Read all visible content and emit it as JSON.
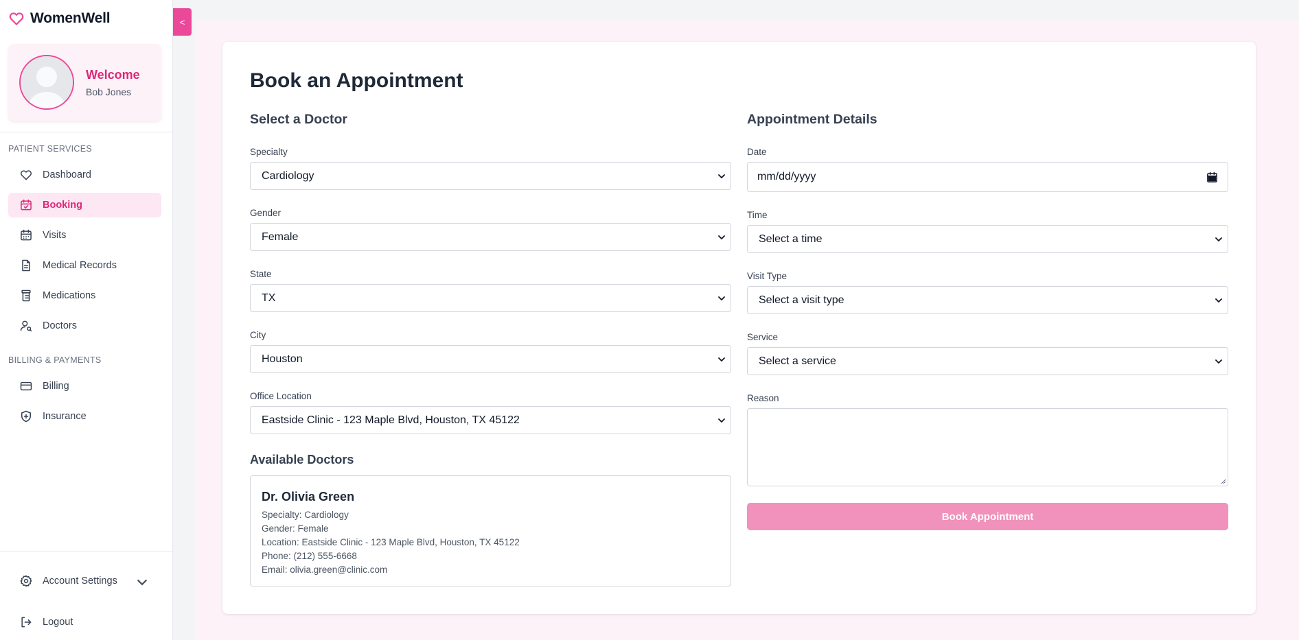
{
  "brand": {
    "name": "WomenWell"
  },
  "user": {
    "welcome": "Welcome",
    "name": "Bob Jones"
  },
  "sidebar": {
    "sections": [
      {
        "label": "PATIENT SERVICES"
      },
      {
        "label": "BILLING & PAYMENTS"
      }
    ],
    "items": [
      {
        "label": "Dashboard",
        "icon": "heart-icon"
      },
      {
        "label": "Booking",
        "icon": "calendar-check-icon",
        "active": true
      },
      {
        "label": "Visits",
        "icon": "calendar-icon"
      },
      {
        "label": "Medical Records",
        "icon": "document-icon"
      },
      {
        "label": "Medications",
        "icon": "pill-bottle-icon"
      },
      {
        "label": "Doctors",
        "icon": "user-search-icon"
      },
      {
        "label": "Billing",
        "icon": "credit-card-icon"
      },
      {
        "label": "Insurance",
        "icon": "shield-plus-icon"
      }
    ],
    "account_settings": "Account Settings",
    "logout": "Logout",
    "collapse": "<"
  },
  "page": {
    "title": "Book an Appointment",
    "doctor_section": "Select a Doctor",
    "details_section": "Appointment Details",
    "available_title": "Available Doctors"
  },
  "doctor_form": {
    "specialty": {
      "label": "Specialty",
      "value": "Cardiology"
    },
    "gender": {
      "label": "Gender",
      "value": "Female"
    },
    "state": {
      "label": "State",
      "value": "TX"
    },
    "city": {
      "label": "City",
      "value": "Houston"
    },
    "office": {
      "label": "Office Location",
      "value": "Eastside Clinic - 123 Maple Blvd, Houston, TX 45122"
    }
  },
  "details_form": {
    "date": {
      "label": "Date",
      "placeholder": "mm/dd/yyyy"
    },
    "time": {
      "label": "Time",
      "value": "Select a time"
    },
    "visit_type": {
      "label": "Visit Type",
      "value": "Select a visit type"
    },
    "service": {
      "label": "Service",
      "value": "Select a service"
    },
    "reason": {
      "label": "Reason",
      "value": ""
    },
    "submit": "Book Appointment"
  },
  "doctors": [
    {
      "name": "Dr. Olivia Green",
      "specialty": "Specialty: Cardiology",
      "gender": "Gender: Female",
      "location": "Location: Eastside Clinic - 123 Maple Blvd, Houston, TX 45122",
      "phone": "Phone: (212) 555-6668",
      "email": "Email: olivia.green@clinic.com"
    }
  ],
  "colors": {
    "accent": "#ec4899",
    "accent_dark": "#db2777",
    "accent_light": "#fce7f3",
    "button_disabled": "#f092bb"
  }
}
